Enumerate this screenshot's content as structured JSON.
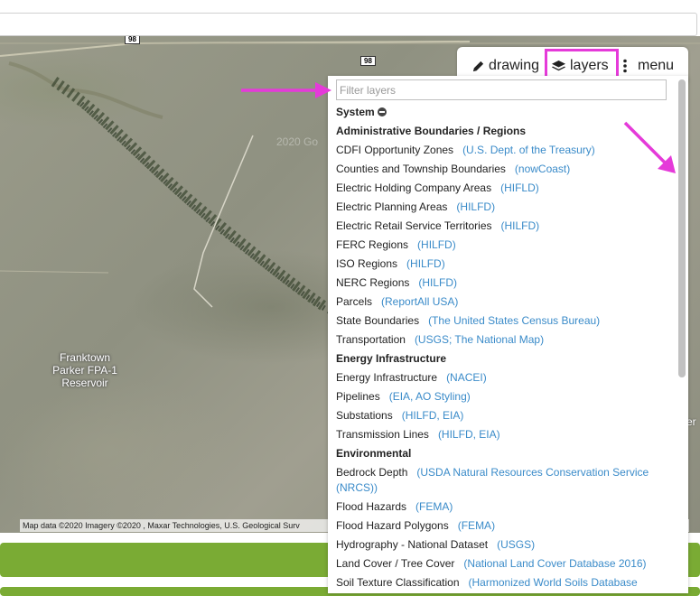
{
  "colors": {
    "accent_magenta": "#e53ad9",
    "link_blue": "#3a8bc9",
    "green_bar": "#7aab34"
  },
  "map": {
    "road_shields": [
      "98",
      "98"
    ],
    "reservoir_label": [
      "Franktown",
      "Parker FPA-1",
      "Reservoir"
    ],
    "watermark": "2020 Go",
    "attribution": "Map data ©2020 Imagery ©2020 , Maxar Technologies, U.S. Geological Surv",
    "attribution_right": "r",
    "edge_text": "er"
  },
  "toolbar": {
    "drawing_label": "drawing",
    "layers_label": "layers",
    "menu_label": "menu",
    "drawing_icon": "pencil-icon",
    "layers_icon": "layers-icon",
    "menu_icon": "vertical-dots-icon"
  },
  "layers_panel": {
    "filter_placeholder": "Filter layers",
    "system_label": "System",
    "groups": [
      {
        "title": "Administrative Boundaries / Regions",
        "items": [
          {
            "name": "CDFI Opportunity Zones",
            "source": "(U.S. Dept. of the Treasury)"
          },
          {
            "name": "Counties and Township Boundaries",
            "source": "(nowCoast)"
          },
          {
            "name": "Electric Holding Company Areas",
            "source": "(HIFLD)"
          },
          {
            "name": "Electric Planning Areas",
            "source": "(HILFD)"
          },
          {
            "name": "Electric Retail Service Territories",
            "source": "(HILFD)"
          },
          {
            "name": "FERC Regions",
            "source": "(HILFD)"
          },
          {
            "name": "ISO Regions",
            "source": "(HILFD)"
          },
          {
            "name": "NERC Regions",
            "source": "(HILFD)"
          },
          {
            "name": "Parcels",
            "source": "(ReportAll USA)"
          },
          {
            "name": "State Boundaries",
            "source": "(The United States Census Bureau)"
          },
          {
            "name": "Transportation",
            "source": "(USGS; The National Map)"
          }
        ]
      },
      {
        "title": "Energy Infrastructure",
        "items": [
          {
            "name": "Energy Infrastructure",
            "source": "(NACEI)"
          },
          {
            "name": "Pipelines",
            "source": "(EIA, AO Styling)"
          },
          {
            "name": "Substations",
            "source": "(HILFD, EIA)"
          },
          {
            "name": "Transmission Lines",
            "source": "(HILFD, EIA)"
          }
        ]
      },
      {
        "title": "Environmental",
        "items": [
          {
            "name": "Bedrock Depth",
            "source": "(USDA Natural Resources Conservation Service (NRCS))"
          },
          {
            "name": "Flood Hazards",
            "source": "(FEMA)"
          },
          {
            "name": "Flood Hazard Polygons",
            "source": "(FEMA)"
          },
          {
            "name": "Hydrography - National Dataset",
            "source": "(USGS)"
          },
          {
            "name": "Land Cover / Tree Cover",
            "source": "(National Land Cover Database 2016)"
          },
          {
            "name": "Soil Texture Classification",
            "source": "(Harmonized World Soils Database (HWSD))"
          }
        ]
      }
    ]
  }
}
